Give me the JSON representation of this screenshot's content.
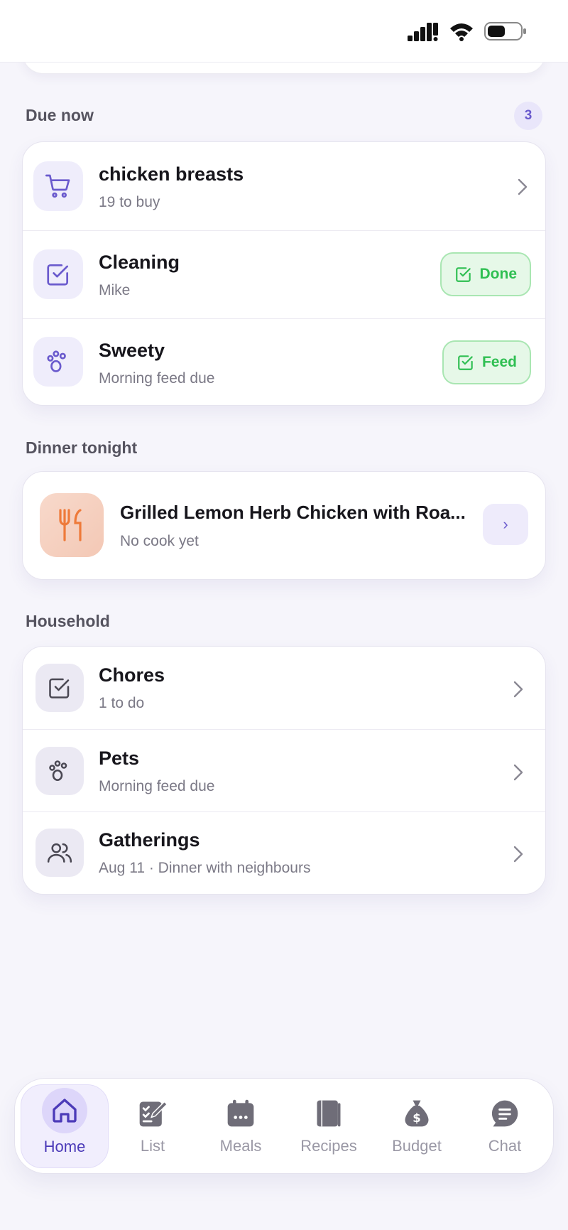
{
  "due_now": {
    "title": "Due now",
    "count": "3",
    "items": [
      {
        "title": "chicken breasts",
        "subtitle": "19 to buy",
        "icon": "cart-icon"
      },
      {
        "title": "Cleaning",
        "subtitle": "Mike",
        "icon": "checkbox-icon",
        "action": "Done"
      },
      {
        "title": "Sweety",
        "subtitle": "Morning feed due",
        "icon": "paw-icon",
        "action": "Feed"
      }
    ]
  },
  "dinner": {
    "title": "Dinner tonight",
    "meal_name": "Grilled Lemon Herb Chicken with Roa...",
    "meal_sub": "No cook yet",
    "arrow": "›"
  },
  "household": {
    "title": "Household",
    "items": [
      {
        "title": "Chores",
        "subtitle": "1 to do",
        "icon": "checkbox-icon"
      },
      {
        "title": "Pets",
        "subtitle": "Morning feed due",
        "icon": "paw-icon"
      },
      {
        "title": "Gatherings",
        "subtitle": "Aug 11 · Dinner with neighbours",
        "icon": "people-icon"
      }
    ]
  },
  "tabs": [
    {
      "label": "Home",
      "icon": "home-icon",
      "active": true
    },
    {
      "label": "List",
      "icon": "list-icon"
    },
    {
      "label": "Meals",
      "icon": "calendar-icon"
    },
    {
      "label": "Recipes",
      "icon": "book-icon"
    },
    {
      "label": "Budget",
      "icon": "money-bag-icon"
    },
    {
      "label": "Chat",
      "icon": "chat-icon"
    }
  ],
  "colors": {
    "accent": "#6a5acd",
    "success": "#2fbf52",
    "success_bg": "#e6f8e8",
    "background": "#f6f5fb"
  }
}
